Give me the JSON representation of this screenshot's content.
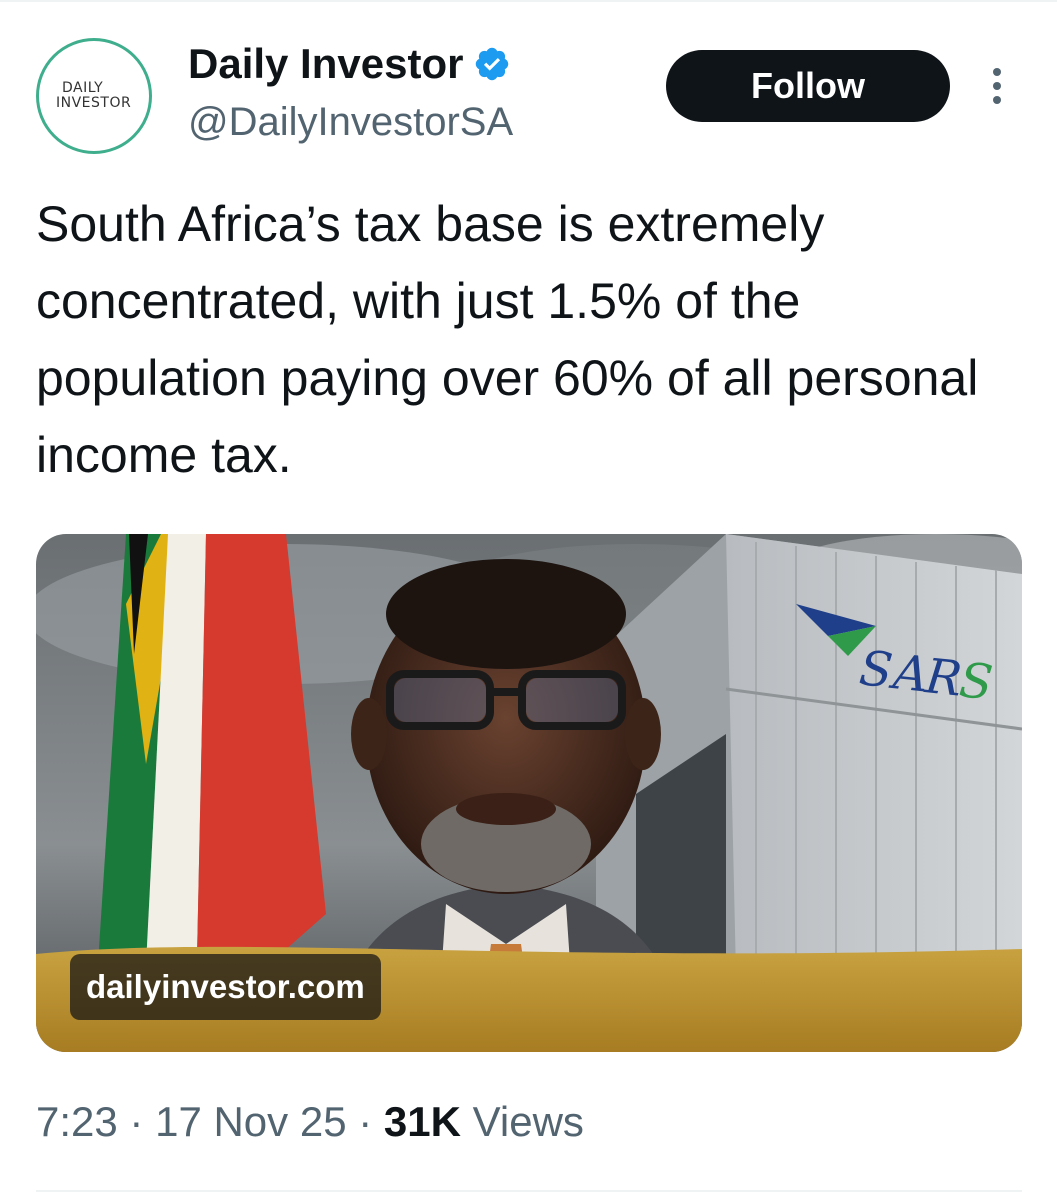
{
  "account": {
    "logo_line1": "DAILY",
    "logo_line2": "INVESTOR",
    "display_name": "Daily Investor",
    "handle": "@DailyInvestorSA",
    "verified_icon": "verified-badge-icon",
    "verified_color": "#1d9bf0"
  },
  "actions": {
    "follow_label": "Follow",
    "more_icon": "more-vertical-icon"
  },
  "tweet": {
    "text": "South Africa’s tax base is extremely concentrated, with just 1.5% of the population paying over 60% of all personal income tax."
  },
  "media": {
    "domain_label": "dailyinvestor.com",
    "building_sign": "SARS"
  },
  "meta": {
    "time": "7:23",
    "separator": "·",
    "date": "17 Nov 25",
    "views_count": "31K",
    "views_label": "Views"
  }
}
